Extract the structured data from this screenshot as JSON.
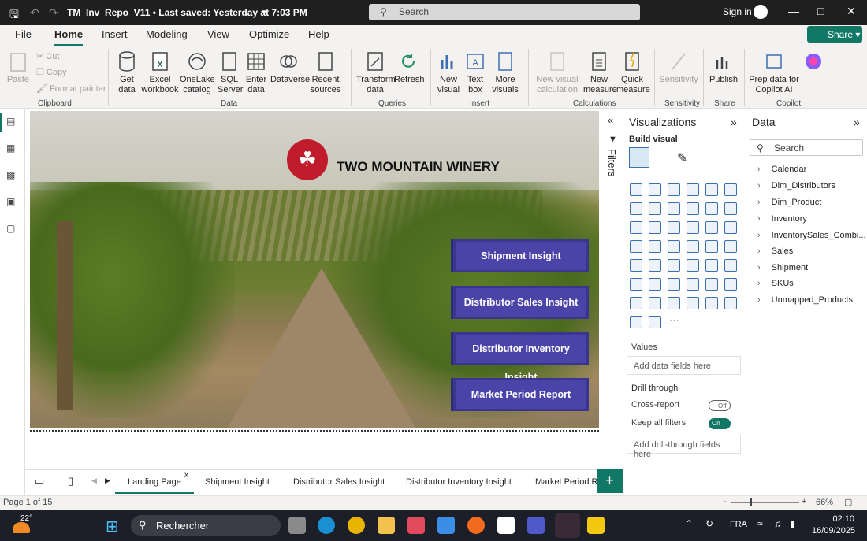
{
  "titlebar": {
    "filename": "TM_Inv_Repo_V11 • Last saved: Yesterday at 7:03 PM",
    "search_placeholder": "Search",
    "signin": "Sign in"
  },
  "menu_tabs": [
    "File",
    "Home",
    "Insert",
    "Modeling",
    "View",
    "Optimize",
    "Help"
  ],
  "share_label": "Share",
  "ribbon": {
    "clipboard": {
      "paste": "Paste",
      "cut": "Cut",
      "copy": "Copy",
      "format_painter": "Format painter",
      "group": "Clipboard"
    },
    "data": {
      "get_data": "Get data",
      "excel": "Excel workbook",
      "onelake": "OneLake catalog",
      "sql": "SQL Server",
      "enter": "Enter data",
      "dataverse": "Dataverse",
      "recent": "Recent sources",
      "group": "Data"
    },
    "queries": {
      "transform": "Transform data",
      "refresh": "Refresh",
      "group": "Queries"
    },
    "insert": {
      "new_visual": "New visual",
      "text_box": "Text box",
      "more_visuals": "More visuals",
      "group": "Insert"
    },
    "calculations": {
      "new_visual_calc": "New visual calculation",
      "new_measure": "New measure",
      "quick_measure": "Quick measure",
      "group": "Calculations"
    },
    "sensitivity": {
      "label": "Sensitivity",
      "group": "Sensitivity"
    },
    "share": {
      "publish": "Publish",
      "group": "Share"
    },
    "copilot": {
      "prep": "Prep data for Copilot AI",
      "copilot": "Copilot",
      "group": "Copilot"
    }
  },
  "report": {
    "winery_name": "TWO MOUNTAIN WINERY",
    "buttons": [
      "Shipment Insight",
      "Distributor Sales Insight",
      "Distributor Inventory Insight",
      "Market Period Report"
    ]
  },
  "filters_label": "Filters",
  "visualizations": {
    "title": "Visualizations",
    "build_visual": "Build visual",
    "values_label": "Values",
    "values_placeholder": "Add data fields here",
    "drill_through": "Drill through",
    "cross_report": "Cross-report",
    "cross_report_state": "Off",
    "keep_filters": "Keep all filters",
    "keep_filters_state": "On",
    "drill_placeholder": "Add drill-through fields here",
    "more": "···"
  },
  "data_pane": {
    "title": "Data",
    "search_placeholder": "Search",
    "tables": [
      "Calendar",
      "Dim_Distributors",
      "Dim_Product",
      "Inventory",
      "InventorySales_Combi...",
      "Sales",
      "Shipment",
      "SKUs",
      "Unmapped_Products"
    ]
  },
  "page_tabs": [
    "Landing Page",
    "Shipment Insight",
    "Distributor Sales Insight",
    "Distributor Inventory Insight",
    "Market Period Re"
  ],
  "status": {
    "page": "Page 1 of 15",
    "zoom": "66%"
  },
  "taskbar": {
    "weather": "22°",
    "search": "Rechercher",
    "lang": "FRA",
    "time": "02:10",
    "date": "16/09/2025"
  }
}
